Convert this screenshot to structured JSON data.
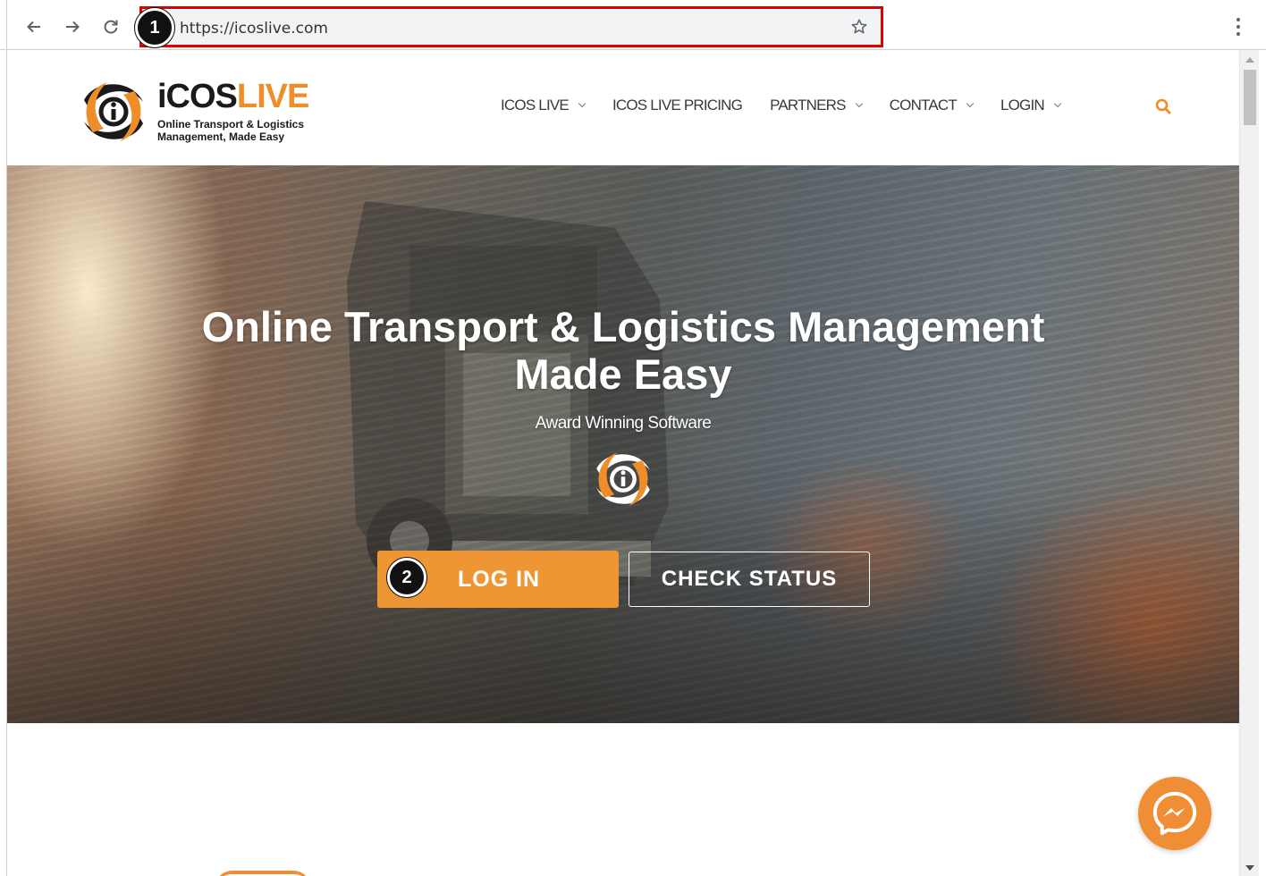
{
  "browser": {
    "url": "https://icoslive.com",
    "back_icon": "arrow-left-icon",
    "forward_icon": "arrow-right-icon",
    "reload_icon": "reload-icon",
    "bookmark_icon": "star-icon",
    "menu_icon": "kebab-menu-icon"
  },
  "annotations": {
    "step1": "1",
    "step2": "2",
    "highlight_color": "#e00000"
  },
  "logo": {
    "word_dark": "iCOS",
    "word_orange": "LIVE",
    "tagline_line1": "Online Transport & Logistics",
    "tagline_line2": "Management, Made Easy"
  },
  "nav": {
    "items": [
      {
        "label": "ICOS LIVE",
        "dropdown": true
      },
      {
        "label": "ICOS LIVE PRICING",
        "dropdown": false
      },
      {
        "label": "PARTNERS",
        "dropdown": true
      },
      {
        "label": "CONTACT",
        "dropdown": true
      },
      {
        "label": "LOGIN",
        "dropdown": true
      }
    ],
    "search_icon": "search-icon"
  },
  "hero": {
    "title_line1": "Online Transport & Logistics Management",
    "title_line2": "Made Easy",
    "subtitle": "Award Winning Software",
    "login_label": "LOG IN",
    "status_label": "CHECK STATUS"
  },
  "colors": {
    "brand_orange": "#ef8e28",
    "button_orange": "#ef9634",
    "text_dark": "#1a1a1a"
  },
  "chat": {
    "icon": "messenger-icon"
  }
}
